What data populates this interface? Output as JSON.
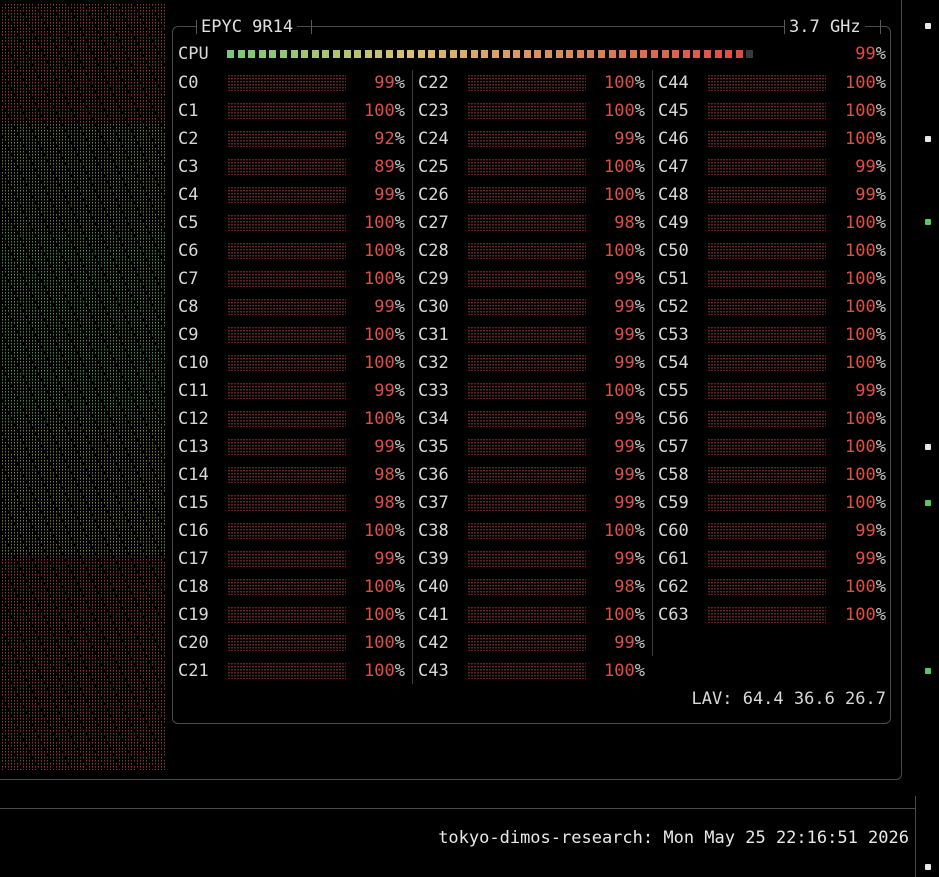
{
  "cpu_box": {
    "model": "EPYC 9R14",
    "frequency": "3.7 GHz",
    "total_label": "CPU",
    "total_percent": "99%",
    "total_value": 99,
    "load_average": "LAV: 64.4 36.6 26.7"
  },
  "cores": [
    {
      "label": "C0",
      "percent": "99%"
    },
    {
      "label": "C1",
      "percent": "100%"
    },
    {
      "label": "C2",
      "percent": "92%"
    },
    {
      "label": "C3",
      "percent": "89%"
    },
    {
      "label": "C4",
      "percent": "99%"
    },
    {
      "label": "C5",
      "percent": "100%"
    },
    {
      "label": "C6",
      "percent": "100%"
    },
    {
      "label": "C7",
      "percent": "100%"
    },
    {
      "label": "C8",
      "percent": "99%"
    },
    {
      "label": "C9",
      "percent": "100%"
    },
    {
      "label": "C10",
      "percent": "100%"
    },
    {
      "label": "C11",
      "percent": "99%"
    },
    {
      "label": "C12",
      "percent": "100%"
    },
    {
      "label": "C13",
      "percent": "99%"
    },
    {
      "label": "C14",
      "percent": "98%"
    },
    {
      "label": "C15",
      "percent": "98%"
    },
    {
      "label": "C16",
      "percent": "100%"
    },
    {
      "label": "C17",
      "percent": "99%"
    },
    {
      "label": "C18",
      "percent": "100%"
    },
    {
      "label": "C19",
      "percent": "100%"
    },
    {
      "label": "C20",
      "percent": "100%"
    },
    {
      "label": "C21",
      "percent": "100%"
    },
    {
      "label": "C22",
      "percent": "100%"
    },
    {
      "label": "C23",
      "percent": "100%"
    },
    {
      "label": "C24",
      "percent": "99%"
    },
    {
      "label": "C25",
      "percent": "100%"
    },
    {
      "label": "C26",
      "percent": "100%"
    },
    {
      "label": "C27",
      "percent": "98%"
    },
    {
      "label": "C28",
      "percent": "100%"
    },
    {
      "label": "C29",
      "percent": "99%"
    },
    {
      "label": "C30",
      "percent": "99%"
    },
    {
      "label": "C31",
      "percent": "99%"
    },
    {
      "label": "C32",
      "percent": "99%"
    },
    {
      "label": "C33",
      "percent": "100%"
    },
    {
      "label": "C34",
      "percent": "99%"
    },
    {
      "label": "C35",
      "percent": "99%"
    },
    {
      "label": "C36",
      "percent": "99%"
    },
    {
      "label": "C37",
      "percent": "99%"
    },
    {
      "label": "C38",
      "percent": "100%"
    },
    {
      "label": "C39",
      "percent": "99%"
    },
    {
      "label": "C40",
      "percent": "98%"
    },
    {
      "label": "C41",
      "percent": "100%"
    },
    {
      "label": "C42",
      "percent": "99%"
    },
    {
      "label": "C43",
      "percent": "100%"
    },
    {
      "label": "C44",
      "percent": "100%"
    },
    {
      "label": "C45",
      "percent": "100%"
    },
    {
      "label": "C46",
      "percent": "100%"
    },
    {
      "label": "C47",
      "percent": "99%"
    },
    {
      "label": "C48",
      "percent": "99%"
    },
    {
      "label": "C49",
      "percent": "100%"
    },
    {
      "label": "C50",
      "percent": "100%"
    },
    {
      "label": "C51",
      "percent": "100%"
    },
    {
      "label": "C52",
      "percent": "100%"
    },
    {
      "label": "C53",
      "percent": "100%"
    },
    {
      "label": "C54",
      "percent": "100%"
    },
    {
      "label": "C55",
      "percent": "99%"
    },
    {
      "label": "C56",
      "percent": "100%"
    },
    {
      "label": "C57",
      "percent": "100%"
    },
    {
      "label": "C58",
      "percent": "100%"
    },
    {
      "label": "C59",
      "percent": "100%"
    },
    {
      "label": "C60",
      "percent": "99%"
    },
    {
      "label": "C61",
      "percent": "99%"
    },
    {
      "label": "C62",
      "percent": "100%"
    },
    {
      "label": "C63",
      "percent": "100%"
    }
  ],
  "status_bar": {
    "text": "tokyo-dimos-research: Mon May 25 22:16:51 2026"
  },
  "colors": {
    "background": "#000000",
    "border": "#4a4a4a",
    "high_load": "#e05040",
    "low_load": "#7cc87c",
    "mid_load": "#d8c070",
    "text": "#d8d8d8"
  }
}
